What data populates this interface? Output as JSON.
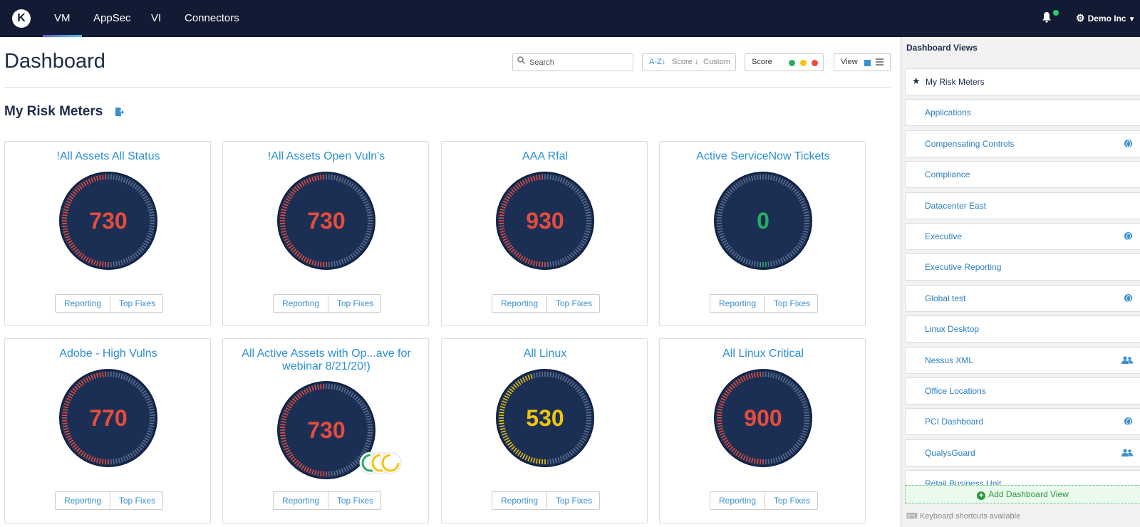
{
  "nav": {
    "logo": "K",
    "items": [
      "VM",
      "AppSec",
      "VI",
      "Connectors"
    ],
    "active": "VM",
    "org": "Demo Inc"
  },
  "main": {
    "title": "Dashboard",
    "search_placeholder": "Search",
    "sort": {
      "az": "A-Z",
      "score": "Score",
      "custom": "Custom"
    },
    "score_label": "Score",
    "view_label": "View",
    "section_title": "My Risk Meters",
    "colors": {
      "low": "#27ae60",
      "medium": "#f1c40f",
      "high": "#e74c3c",
      "gauge_bg": "#1b2f55"
    }
  },
  "cards": [
    {
      "title": "!All Assets All Status",
      "score": "730",
      "level": "high"
    },
    {
      "title": "!All Assets Open Vuln's",
      "score": "730",
      "level": "high"
    },
    {
      "title": "AAA Rfal",
      "score": "930",
      "level": "high"
    },
    {
      "title": "Active ServiceNow Tickets",
      "score": "0",
      "level": "low"
    },
    {
      "title": "Adobe - High Vulns",
      "score": "770",
      "level": "high"
    },
    {
      "title": "All Active Assets with Op...ave for webinar 8/21/20!)",
      "score": "730",
      "level": "high"
    },
    {
      "title": "All Linux",
      "score": "530",
      "level": "medium"
    },
    {
      "title": "All Linux Critical",
      "score": "900",
      "level": "high"
    }
  ],
  "card_buttons": {
    "reporting": "Reporting",
    "top_fixes": "Top Fixes"
  },
  "sidebar": {
    "title": "Dashboard Views",
    "items": [
      {
        "label": "My Risk Meters",
        "icon": "star-icon"
      },
      {
        "label": "Applications",
        "icon": ""
      },
      {
        "label": "Compensating Controls",
        "icon": "globe-icon"
      },
      {
        "label": "Compliance",
        "icon": ""
      },
      {
        "label": "Datacenter East",
        "icon": ""
      },
      {
        "label": "Executive",
        "icon": "globe-icon"
      },
      {
        "label": "Executive Reporting",
        "icon": ""
      },
      {
        "label": "Global test",
        "icon": "globe-icon"
      },
      {
        "label": "Linux Desktop",
        "icon": ""
      },
      {
        "label": "Nessus XML",
        "icon": "users-icon"
      },
      {
        "label": "Office Locations",
        "icon": ""
      },
      {
        "label": "PCI Dashboard",
        "icon": "globe-icon"
      },
      {
        "label": "QualysGuard",
        "icon": "users-icon"
      },
      {
        "label": "Retail Business Unit",
        "icon": ""
      }
    ],
    "add_label": "Add Dashboard View",
    "shortcuts": "Keyboard shortcuts available"
  }
}
